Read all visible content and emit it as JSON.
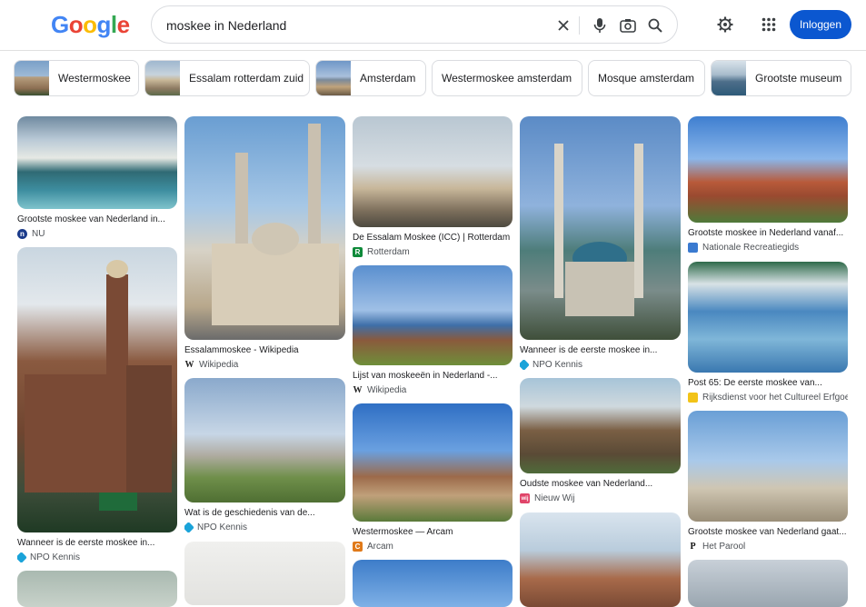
{
  "search": {
    "query": "moskee in Nederland"
  },
  "header": {
    "login_label": "Inloggen"
  },
  "logo": {
    "letters": [
      "G",
      "o",
      "o",
      "g",
      "l",
      "e"
    ],
    "colors": [
      "#4285F4",
      "#EA4335",
      "#FBBC05",
      "#4285F4",
      "#34A853",
      "#EA4335"
    ]
  },
  "chips": [
    {
      "label": "Westermoskee"
    },
    {
      "label": "Essalam rotterdam zuid"
    },
    {
      "label": "Amsterdam"
    },
    {
      "label": "Westermoskee amsterdam"
    },
    {
      "label": "Mosque amsterdam"
    },
    {
      "label": "Grootste museum"
    }
  ],
  "results": [
    {
      "title": "Grootste moskee van Nederland in...",
      "source": "NU",
      "fav": "nu"
    },
    {
      "title": "Wanneer is de eerste moskee in...",
      "source": "NPO Kennis",
      "fav": "npo"
    },
    {
      "title": "Essalammoskee - Wikipedia",
      "source": "Wikipedia",
      "fav": "wiki"
    },
    {
      "title": "Wat is de geschiedenis van de...",
      "source": "NPO Kennis",
      "fav": "npo"
    },
    {
      "title": "De Essalam Moskee (ICC) | Rotterdam",
      "source": "Rotterdam",
      "fav": "rdam"
    },
    {
      "title": "Lijst van moskeeën in Nederland -...",
      "source": "Wikipedia",
      "fav": "wiki"
    },
    {
      "title": "Westermoskee — Arcam",
      "source": "Arcam",
      "fav": "arcam"
    },
    {
      "title": "Wanneer is de eerste moskee in...",
      "source": "NPO Kennis",
      "fav": "npo"
    },
    {
      "title": "Oudste moskee van Nederland...",
      "source": "Nieuw Wij",
      "fav": "wij"
    },
    {
      "title": "Grootste moskee in Nederland vanaf...",
      "source": "Nationale Recreatiegids",
      "fav": "nrg"
    },
    {
      "title": "Post 65: De eerste moskee van...",
      "source": "Rijksdienst voor het Cultureel Erfgoed",
      "fav": "rce"
    },
    {
      "title": "Grootste moskee van Nederland gaat...",
      "source": "Het Parool",
      "fav": "parool"
    }
  ],
  "colors": {
    "accent": "#0b57d0"
  }
}
